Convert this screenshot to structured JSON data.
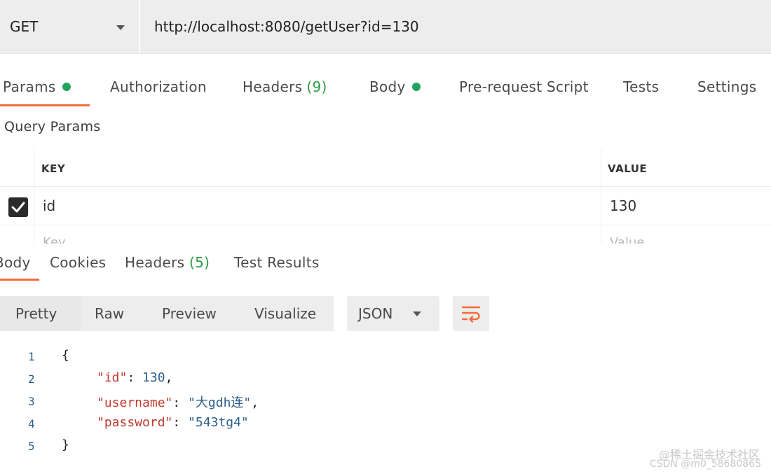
{
  "request": {
    "method": "GET",
    "url": "http://localhost:8080/getUser?id=130"
  },
  "request_tabs": {
    "params": "Params",
    "authorization": "Authorization",
    "headers": "Headers",
    "headers_count": "(9)",
    "body": "Body",
    "pre_request": "Pre-request Script",
    "tests": "Tests",
    "settings": "Settings"
  },
  "query_params": {
    "label": "Query Params",
    "key_header": "KEY",
    "value_header": "VALUE",
    "rows": [
      {
        "key": "id",
        "value": "130",
        "checked": true
      }
    ],
    "key_placeholder": "Key",
    "value_placeholder": "Value"
  },
  "response_tabs": {
    "body": "Body",
    "cookies": "Cookies",
    "headers": "Headers",
    "headers_count": "(5)",
    "test_results": "Test Results"
  },
  "view_modes": {
    "pretty": "Pretty",
    "raw": "Raw",
    "preview": "Preview",
    "visualize": "Visualize"
  },
  "format": {
    "selected": "JSON"
  },
  "code": {
    "line_numbers": [
      "1",
      "2",
      "3",
      "4",
      "5"
    ],
    "open_brace": "{",
    "close_brace": "}",
    "fields": [
      {
        "key": "\"id\"",
        "value": "130",
        "suffix": ","
      },
      {
        "key": "\"username\"",
        "value": "\"大gdh连\"",
        "suffix": ","
      },
      {
        "key": "\"password\"",
        "value": "\"543tg4\"",
        "suffix": ""
      }
    ]
  },
  "watermark": {
    "line1": "@稀土掘金技术社区",
    "line2": "CSDN @m0_58680865"
  },
  "colors": {
    "accent": "#f26b3a",
    "status_dot": "#20a35a",
    "json_key": "#c0392b",
    "json_value": "#2c5f8a"
  }
}
